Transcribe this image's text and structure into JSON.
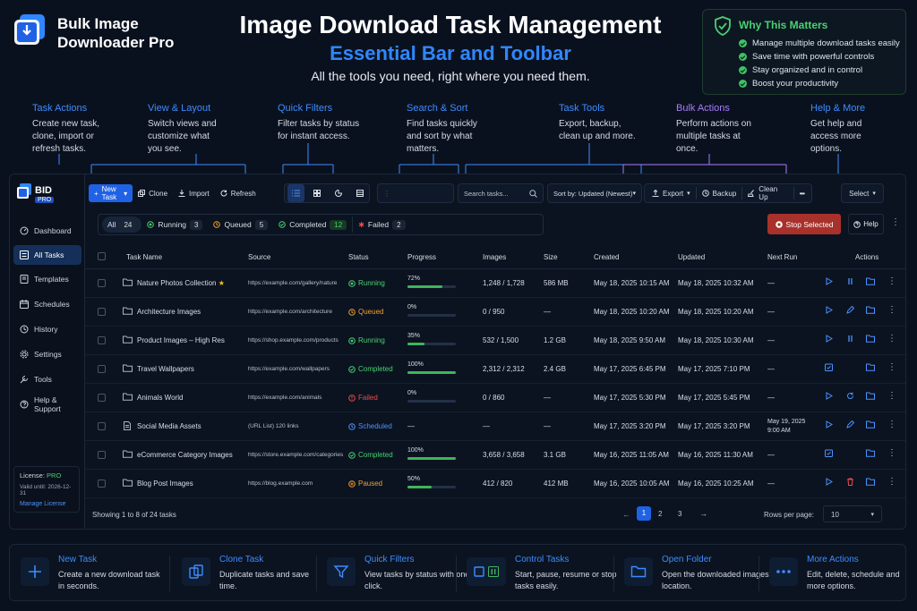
{
  "header": {
    "app_name": "Bulk Image Downloader Pro",
    "title": "Image Download Task Management",
    "subtitle": "Essential Bar and Toolbar",
    "tagline": "All the tools you need, right where you need them."
  },
  "why": {
    "title": "Why This Matters",
    "items": [
      "Manage multiple download tasks easily",
      "Save time with powerful controls",
      "Stay organized and in control",
      "Boost your productivity"
    ]
  },
  "annotations": [
    {
      "title": "Task Actions",
      "text": "Create new task, clone, import or refresh tasks."
    },
    {
      "title": "View & Layout",
      "text": "Switch views and customize what you see."
    },
    {
      "title": "Quick Filters",
      "text": "Filter tasks by status for instant access."
    },
    {
      "title": "Search & Sort",
      "text": "Find tasks quickly and sort by what matters."
    },
    {
      "title": "Task Tools",
      "text": "Export, backup, clean up and more."
    },
    {
      "title": "Bulk Actions",
      "text": "Perform actions on multiple tasks at once."
    },
    {
      "title": "Help & More",
      "text": "Get help and access more options."
    }
  ],
  "sidebar": {
    "brand": "BID",
    "badge": "PRO",
    "items": [
      {
        "label": "Dashboard",
        "icon": "dashboard-icon"
      },
      {
        "label": "All Tasks",
        "icon": "list-icon"
      },
      {
        "label": "Templates",
        "icon": "template-icon"
      },
      {
        "label": "Schedules",
        "icon": "calendar-icon"
      },
      {
        "label": "History",
        "icon": "history-icon"
      },
      {
        "label": "Settings",
        "icon": "gear-icon"
      },
      {
        "label": "Tools",
        "icon": "tools-icon"
      },
      {
        "label": "Help & Support",
        "icon": "help-icon"
      }
    ],
    "license_label": "License:",
    "license_value": "PRO",
    "valid_until": "Valid until: 2026-12-31",
    "manage": "Manage License"
  },
  "toolbar": {
    "new_task": "New Task",
    "clone": "Clone",
    "import": "Import",
    "refresh": "Refresh",
    "search_placeholder": "Search tasks...",
    "sort": "Sort by: Updated (Newest)",
    "export": "Export",
    "backup": "Backup",
    "cleanup": "Clean Up",
    "more": "•••",
    "select": "Select"
  },
  "filters": [
    {
      "label": "All",
      "count": "24"
    },
    {
      "label": "Running",
      "count": "3"
    },
    {
      "label": "Queued",
      "count": "5"
    },
    {
      "label": "Completed",
      "count": "12"
    },
    {
      "label": "Failed",
      "count": "2"
    }
  ],
  "stop_selected": "Stop Selected",
  "help": "Help",
  "columns": [
    "Task Name",
    "Source",
    "Status",
    "Progress",
    "Images",
    "Size",
    "Created",
    "Updated",
    "Next Run",
    "Actions"
  ],
  "rows": [
    {
      "name": "Nature Photos Collection",
      "star": "★",
      "source": "https://example.com/gallery/nature",
      "status": "Running",
      "progress": 72,
      "progress_label": "72%",
      "images": "1,248 / 1,728",
      "size": "586 MB",
      "created": "May 18, 2025 10:15 AM",
      "updated": "May 18, 2025 10:32 AM",
      "next_run": "—",
      "doc": false
    },
    {
      "name": "Architecture Images",
      "star": "",
      "source": "https://example.com/architecture",
      "status": "Queued",
      "progress": 0,
      "progress_label": "0%",
      "images": "0 / 950",
      "size": "—",
      "created": "May 18, 2025 10:20 AM",
      "updated": "May 18, 2025 10:20 AM",
      "next_run": "—",
      "doc": false
    },
    {
      "name": "Product Images – High Res",
      "star": "",
      "source": "https://shop.example.com/products",
      "status": "Running",
      "progress": 35,
      "progress_label": "35%",
      "images": "532 / 1,500",
      "size": "1.2 GB",
      "created": "May 18, 2025 9:50 AM",
      "updated": "May 18, 2025 10:30 AM",
      "next_run": "—",
      "doc": false
    },
    {
      "name": "Travel Wallpapers",
      "star": "",
      "source": "https://example.com/wallpapers",
      "status": "Completed",
      "progress": 100,
      "progress_label": "100%",
      "images": "2,312 / 2,312",
      "size": "2.4 GB",
      "created": "May 17, 2025 6:45 PM",
      "updated": "May 17, 2025 7:10 PM",
      "next_run": "—",
      "doc": false
    },
    {
      "name": "Animals World",
      "star": "",
      "source": "https://example.com/animals",
      "status": "Failed",
      "progress": 0,
      "progress_label": "0%",
      "images": "0 / 860",
      "size": "—",
      "created": "May 17, 2025 5:30 PM",
      "updated": "May 17, 2025 5:45 PM",
      "next_run": "—",
      "doc": false
    },
    {
      "name": "Social Media Assets",
      "star": "",
      "source": "(URL List)  120 links",
      "status": "Scheduled",
      "progress": null,
      "progress_label": "—",
      "images": "—",
      "size": "—",
      "created": "May 17, 2025 3:20 PM",
      "updated": "May 17, 2025 3:20 PM",
      "next_run": "May 19, 2025 9:00 AM",
      "doc": true
    },
    {
      "name": "eCommerce Category Images",
      "star": "",
      "source": "https://store.example.com/categories",
      "status": "Completed",
      "progress": 100,
      "progress_label": "100%",
      "images": "3,658 / 3,658",
      "size": "3.1 GB",
      "created": "May 16, 2025 11:05 AM",
      "updated": "May 16, 2025 11:30 AM",
      "next_run": "—",
      "doc": false
    },
    {
      "name": "Blog Post Images",
      "star": "",
      "source": "https://blog.example.com",
      "status": "Paused",
      "progress": 50,
      "progress_label": "50%",
      "images": "412 / 820",
      "size": "412 MB",
      "created": "May 16, 2025 10:05 AM",
      "updated": "May 16, 2025 10:25 AM",
      "next_run": "—",
      "doc": false
    }
  ],
  "footer": {
    "showing": "Showing 1 to 8 of 24 tasks",
    "pages": [
      "1",
      "2",
      "3"
    ],
    "rows_per_page_label": "Rows per page:",
    "rows_per_page": "10"
  },
  "cards": [
    {
      "title": "New Task",
      "text": "Create a new download task in seconds.",
      "icon": "plus-icon"
    },
    {
      "title": "Clone Task",
      "text": "Duplicate tasks and save time.",
      "icon": "clone-icon"
    },
    {
      "title": "Quick Filters",
      "text": "View tasks by status with one click.",
      "icon": "filter-icon"
    },
    {
      "title": "Control Tasks",
      "text": "Start, pause, resume or stop tasks easily.",
      "icon": "stop-pause-icon"
    },
    {
      "title": "Open Folder",
      "text": "Open the downloaded images location.",
      "icon": "folder-icon"
    },
    {
      "title": "More Actions",
      "text": "Edit, delete, schedule and more options.",
      "icon": "more-icon"
    }
  ],
  "colors": {
    "accent": "#1f62e6",
    "running": "#49d171",
    "queued": "#f0a030",
    "completed": "#49d171",
    "failed": "#ef4a4a",
    "scheduled": "#4c93ff",
    "paused": "#f0a030",
    "bulk": "#a87cff",
    "stop": "#c0392b"
  }
}
